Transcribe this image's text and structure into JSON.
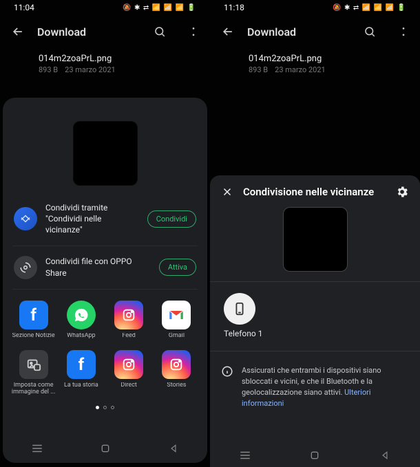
{
  "left": {
    "status_time": "11:04",
    "header": {
      "title": "Download"
    },
    "file": {
      "name": "014m2zoaPrL.png",
      "size": "893 B",
      "date": "23 marzo 2021"
    },
    "nearby": {
      "line1": "Condividi tramite",
      "line2": "\"Condividi nelle vicinanze\"",
      "button": "Condividi"
    },
    "oppo": {
      "label": "Condividi file con OPPO Share",
      "button": "Attiva"
    },
    "apps": [
      {
        "id": "facebook-news",
        "label": "Sezione Notizie"
      },
      {
        "id": "whatsapp",
        "label": "WhatsApp"
      },
      {
        "id": "instagram-feed",
        "label": "Feed"
      },
      {
        "id": "gmail",
        "label": "Gmail"
      },
      {
        "id": "set-as-image",
        "label": "Imposta come immagine del ..."
      },
      {
        "id": "facebook-story",
        "label": "La tua storia"
      },
      {
        "id": "instagram-direct",
        "label": "Direct"
      },
      {
        "id": "instagram-stories",
        "label": "Stories"
      }
    ]
  },
  "right": {
    "status_time": "11:18",
    "header": {
      "title": "Download"
    },
    "file": {
      "name": "014m2zoaPrL.png",
      "size": "893 B",
      "date": "23 marzo 2021"
    },
    "panel": {
      "title": "Condivisione nelle vicinanze",
      "device": "Telefono 1",
      "info": "Assicurati che entrambi i dispositivi siano sbloccati e vicini, e che il Bluetooth e la geolocalizzazione siano attivi.",
      "info_link": "Ulteriori informazioni"
    }
  }
}
